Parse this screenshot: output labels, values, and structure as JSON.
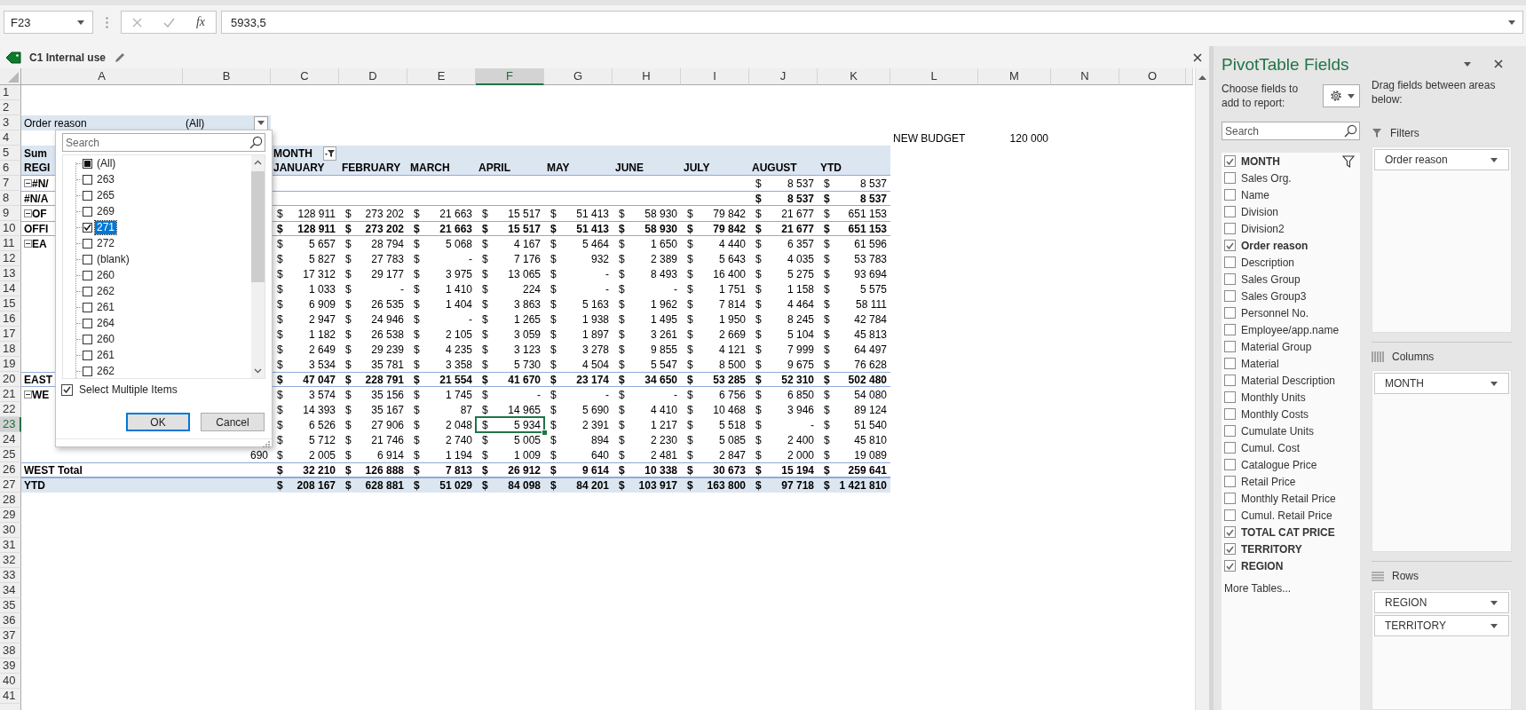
{
  "formula_bar": {
    "name_box": "F23",
    "function_label": "fx",
    "formula": "5933,5"
  },
  "info_bar": {
    "label": "C1 Internal use"
  },
  "sheet": {
    "columns": [
      {
        "label": "A",
        "selected": false
      },
      {
        "label": "B",
        "selected": false
      },
      {
        "label": "C",
        "selected": false
      },
      {
        "label": "D",
        "selected": false
      },
      {
        "label": "E",
        "selected": false
      },
      {
        "label": "F",
        "selected": true
      },
      {
        "label": "G",
        "selected": false
      },
      {
        "label": "H",
        "selected": false
      },
      {
        "label": "I",
        "selected": false
      },
      {
        "label": "J",
        "selected": false
      },
      {
        "label": "K",
        "selected": false
      },
      {
        "label": "L",
        "selected": false
      },
      {
        "label": "M",
        "selected": false
      },
      {
        "label": "N",
        "selected": false
      },
      {
        "label": "O",
        "selected": false
      }
    ],
    "rows": [
      {
        "label": "1",
        "selected": false
      },
      {
        "label": "2",
        "selected": false
      },
      {
        "label": "3",
        "selected": false
      },
      {
        "label": "4",
        "selected": false
      },
      {
        "label": "5",
        "selected": false
      },
      {
        "label": "6",
        "selected": false
      },
      {
        "label": "7",
        "selected": false
      },
      {
        "label": "8",
        "selected": false
      },
      {
        "label": "9",
        "selected": false
      },
      {
        "label": "10",
        "selected": false
      },
      {
        "label": "11",
        "selected": false
      },
      {
        "label": "12",
        "selected": false
      },
      {
        "label": "13",
        "selected": false
      },
      {
        "label": "14",
        "selected": false
      },
      {
        "label": "15",
        "selected": false
      },
      {
        "label": "16",
        "selected": false
      },
      {
        "label": "17",
        "selected": false
      },
      {
        "label": "18",
        "selected": false
      },
      {
        "label": "19",
        "selected": false
      },
      {
        "label": "20",
        "selected": false
      },
      {
        "label": "21",
        "selected": false
      },
      {
        "label": "22",
        "selected": false
      },
      {
        "label": "23",
        "selected": true
      },
      {
        "label": "24",
        "selected": false
      },
      {
        "label": "25",
        "selected": false
      },
      {
        "label": "26",
        "selected": false
      },
      {
        "label": "27",
        "selected": false
      },
      {
        "label": "28",
        "selected": false
      },
      {
        "label": "29",
        "selected": false
      },
      {
        "label": "30",
        "selected": false
      },
      {
        "label": "31",
        "selected": false
      },
      {
        "label": "32",
        "selected": false
      },
      {
        "label": "33",
        "selected": false
      },
      {
        "label": "34",
        "selected": false
      },
      {
        "label": "35",
        "selected": false
      },
      {
        "label": "36",
        "selected": false
      },
      {
        "label": "37",
        "selected": false
      },
      {
        "label": "38",
        "selected": false
      },
      {
        "label": "39",
        "selected": false
      },
      {
        "label": "40",
        "selected": false
      },
      {
        "label": "41",
        "selected": false
      }
    ],
    "pivot": {
      "filter": {
        "field": "Order reason",
        "value": "(All)"
      },
      "budget": {
        "label": "NEW BUDGET",
        "value": "120 000"
      },
      "corner": [
        "Sum",
        "REGI"
      ],
      "column_field": "MONTH",
      "months": [
        "JANUARY",
        "FEBRUARY",
        "MARCH",
        "APRIL",
        "MAY",
        "JUNE",
        "JULY",
        "AUGUST",
        "YTD"
      ],
      "body": [
        {
          "kind": "group",
          "label": "#N/",
          "expanded": true,
          "values": [
            "$ 8 537",
            "$ 8 537"
          ]
        },
        {
          "kind": "subtotal",
          "label": "#N/A",
          "values": [
            "$ 8 537",
            "$ 8 537"
          ]
        },
        {
          "kind": "group",
          "label": "OF",
          "expanded": true,
          "values": [
            "$ 128 911",
            "$ 273 202",
            "$ 21 663",
            "$ 15 517",
            "$ 51 413",
            "$ 58 930",
            "$ 79 842",
            "$ 21 677",
            "$ 651 153"
          ]
        },
        {
          "kind": "subtotal",
          "label": "OFFI",
          "values": [
            "$ 128 911",
            "$ 273 202",
            "$ 21 663",
            "$ 15 517",
            "$ 51 413",
            "$ 58 930",
            "$ 79 842",
            "$ 21 677",
            "$ 651 153"
          ]
        },
        {
          "kind": "group",
          "label": "EA",
          "expanded": true,
          "values": [
            "$ 5 657",
            "$ 28 794",
            "$ 5 068",
            "$ 4 167",
            "$ 5 464",
            "$ 1 650",
            "$ 4 440",
            "$ 6 357",
            "$ 61 596"
          ]
        },
        {
          "kind": "item",
          "values": [
            "$ 5 827",
            "$ 27 783",
            "$ -",
            "$ 7 176",
            "$ 932",
            "$ 2 389",
            "$ 5 643",
            "$ 4 035",
            "$ 53 783"
          ]
        },
        {
          "kind": "item",
          "values": [
            "$ 17 312",
            "$ 29 177",
            "$ 3 975",
            "$ 13 065",
            "$ -",
            "$ 8 493",
            "$ 16 400",
            "$ 5 275",
            "$ 93 694"
          ]
        },
        {
          "kind": "item",
          "values": [
            "$ 1 033",
            "$ -",
            "$ 1 410",
            "$ 224",
            "$ -",
            "$ -",
            "$ 1 751",
            "$ 1 158",
            "$ 5 575"
          ]
        },
        {
          "kind": "item",
          "values": [
            "$ 6 909",
            "$ 26 535",
            "$ 1 404",
            "$ 3 863",
            "$ 5 163",
            "$ 1 962",
            "$ 7 814",
            "$ 4 464",
            "$ 58 111"
          ]
        },
        {
          "kind": "item",
          "values": [
            "$ 2 947",
            "$ 24 946",
            "$ -",
            "$ 1 265",
            "$ 1 938",
            "$ 1 495",
            "$ 1 950",
            "$ 8 245",
            "$ 42 784"
          ]
        },
        {
          "kind": "item",
          "values": [
            "$ 1 182",
            "$ 26 538",
            "$ 2 105",
            "$ 3 059",
            "$ 1 897",
            "$ 3 261",
            "$ 2 669",
            "$ 5 104",
            "$ 45 813"
          ]
        },
        {
          "kind": "item",
          "values": [
            "$ 2 649",
            "$ 29 239",
            "$ 4 235",
            "$ 3 123",
            "$ 3 278",
            "$ 9 855",
            "$ 4 121",
            "$ 7 999",
            "$ 64 497"
          ]
        },
        {
          "kind": "item",
          "values": [
            "$ 3 534",
            "$ 35 781",
            "$ 3 358",
            "$ 5 730",
            "$ 4 504",
            "$ 5 547",
            "$ 8 500",
            "$ 9 675",
            "$ 76 628"
          ]
        },
        {
          "kind": "subtotal",
          "label": "EAST",
          "values": [
            "$ 47 047",
            "$ 228 791",
            "$ 21 554",
            "$ 41 670",
            "$ 23 174",
            "$ 34 650",
            "$ 53 285",
            "$ 52 310",
            "$ 502 480"
          ]
        },
        {
          "kind": "group",
          "label": "WE",
          "expanded": true,
          "values": [
            "$ 3 574",
            "$ 35 156",
            "$ 1 745",
            "$ -",
            "$ -",
            "$ -",
            "$ 6 756",
            "$ 6 850",
            "$ 54 080"
          ]
        },
        {
          "kind": "item",
          "values": [
            "$ 14 393",
            "$ 35 167",
            "$ 87",
            "$ 14 965",
            "$ 5 690",
            "$ 4 410",
            "$ 10 468",
            "$ 3 946",
            "$ 89 124"
          ]
        },
        {
          "kind": "item",
          "values": [
            "$ 6 526",
            "$ 27 906",
            "$ 2 048",
            "$ 5 934",
            "$ 2 391",
            "$ 1 217",
            "$ 5 518",
            "$ -",
            "$ 51 540"
          ]
        },
        {
          "kind": "item",
          "values": [
            "$ 5 712",
            "$ 21 746",
            "$ 2 740",
            "$ 5 005",
            "$ 894",
            "$ 2 230",
            "$ 5 085",
            "$ 2 400",
            "$ 45 810"
          ]
        },
        {
          "kind": "item",
          "territory": "690",
          "values": [
            "$ 2 005",
            "$ 6 914",
            "$ 1 194",
            "$ 1 009",
            "$ 640",
            "$ 2 481",
            "$ 2 847",
            "$ 2 000",
            "$ 19 089"
          ]
        },
        {
          "kind": "subtotal",
          "label": "WEST Total",
          "values": [
            "$ 32 210",
            "$ 126 888",
            "$ 7 813",
            "$ 26 912",
            "$ 9 614",
            "$ 10 338",
            "$ 30 673",
            "$ 15 194",
            "$ 259 641"
          ]
        },
        {
          "kind": "grand",
          "label": "YTD",
          "values": [
            "$ 208 167",
            "$ 628 881",
            "$ 51 029",
            "$ 84 098",
            "$ 84 201",
            "$ 103 917",
            "$ 163 800",
            "$ 97 718",
            "$ 1 421 810"
          ]
        }
      ]
    },
    "filter_dropdown": {
      "search_placeholder": "Search",
      "items": [
        {
          "label": "(All)",
          "checked": false,
          "partial": true,
          "selected": false
        },
        {
          "label": "263",
          "checked": false,
          "partial": false,
          "selected": false
        },
        {
          "label": "265",
          "checked": false,
          "partial": false,
          "selected": false
        },
        {
          "label": "269",
          "checked": false,
          "partial": false,
          "selected": false
        },
        {
          "label": "271",
          "checked": true,
          "partial": false,
          "selected": true
        },
        {
          "label": "272",
          "checked": false,
          "partial": false,
          "selected": false
        },
        {
          "label": "(blank)",
          "checked": false,
          "partial": false,
          "selected": false
        },
        {
          "label": "260",
          "checked": false,
          "partial": false,
          "selected": false
        },
        {
          "label": "262",
          "checked": false,
          "partial": false,
          "selected": false
        },
        {
          "label": "261",
          "checked": false,
          "partial": false,
          "selected": false
        },
        {
          "label": "264",
          "checked": false,
          "partial": false,
          "selected": false
        },
        {
          "label": "260",
          "checked": false,
          "partial": false,
          "selected": false
        },
        {
          "label": "261",
          "checked": false,
          "partial": false,
          "selected": false
        },
        {
          "label": "262",
          "checked": false,
          "partial": false,
          "selected": false
        }
      ],
      "multi": {
        "label": "Select Multiple Items",
        "checked": true
      },
      "buttons": [
        {
          "label": "OK",
          "default": true
        },
        {
          "label": "Cancel",
          "default": false
        }
      ]
    }
  },
  "pivot_panel": {
    "title": "PivotTable Fields",
    "choose_label": "Choose fields to add to report:",
    "search_placeholder": "Search",
    "fields": [
      {
        "label": "MONTH",
        "checked": true,
        "filtered": true
      },
      {
        "label": "Sales Org.",
        "checked": false,
        "filtered": false
      },
      {
        "label": "Name",
        "checked": false,
        "filtered": false
      },
      {
        "label": "Division",
        "checked": false,
        "filtered": false
      },
      {
        "label": "Division2",
        "checked": false,
        "filtered": false
      },
      {
        "label": "Order reason",
        "checked": true,
        "filtered": false
      },
      {
        "label": "Description",
        "checked": false,
        "filtered": false
      },
      {
        "label": "Sales Group",
        "checked": false,
        "filtered": false
      },
      {
        "label": "Sales Group3",
        "checked": false,
        "filtered": false
      },
      {
        "label": "Personnel No.",
        "checked": false,
        "filtered": false
      },
      {
        "label": "Employee/app.name",
        "checked": false,
        "filtered": false
      },
      {
        "label": "Material Group",
        "checked": false,
        "filtered": false
      },
      {
        "label": "Material",
        "checked": false,
        "filtered": false
      },
      {
        "label": "Material Description",
        "checked": false,
        "filtered": false
      },
      {
        "label": "Monthly Units",
        "checked": false,
        "filtered": false
      },
      {
        "label": "Monthly Costs",
        "checked": false,
        "filtered": false
      },
      {
        "label": "Cumulate Units",
        "checked": false,
        "filtered": false
      },
      {
        "label": "Cumul. Cost",
        "checked": false,
        "filtered": false
      },
      {
        "label": "Catalogue Price",
        "checked": false,
        "filtered": false
      },
      {
        "label": "Retail Price",
        "checked": false,
        "filtered": false
      },
      {
        "label": "Monthly Retail Price",
        "checked": false,
        "filtered": false
      },
      {
        "label": "Cumul. Retail Price",
        "checked": false,
        "filtered": false
      },
      {
        "label": "TOTAL CAT PRICE",
        "checked": true,
        "filtered": false
      },
      {
        "label": "TERRITORY",
        "checked": true,
        "filtered": false
      },
      {
        "label": "REGION",
        "checked": true,
        "filtered": false
      }
    ],
    "more_tables": "More Tables...",
    "drag_label": "Drag fields between areas below:",
    "areas": [
      {
        "kind": "filters",
        "title": "Filters",
        "fields": [
          "Order reason"
        ]
      },
      {
        "kind": "columns",
        "title": "Columns",
        "fields": [
          "MONTH"
        ]
      },
      {
        "kind": "rows",
        "title": "Rows",
        "fields": [
          "REGION",
          "TERRITORY"
        ]
      }
    ]
  }
}
